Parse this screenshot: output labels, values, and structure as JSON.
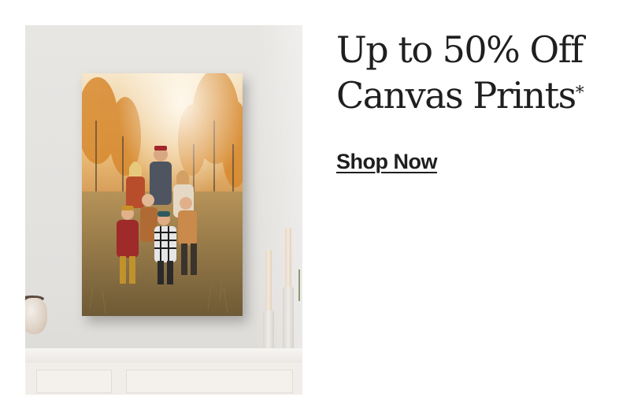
{
  "promo": {
    "headline_line1": "Up to 50% Off",
    "headline_line2": "Canvas Prints",
    "headline_asterisk": "*",
    "cta_label": "Shop Now"
  },
  "image": {
    "subject": "canvas-print-of-family-in-autumn-field-on-wall-above-mantel"
  },
  "colors": {
    "text": "#1f1f1f",
    "background": "#ffffff"
  }
}
